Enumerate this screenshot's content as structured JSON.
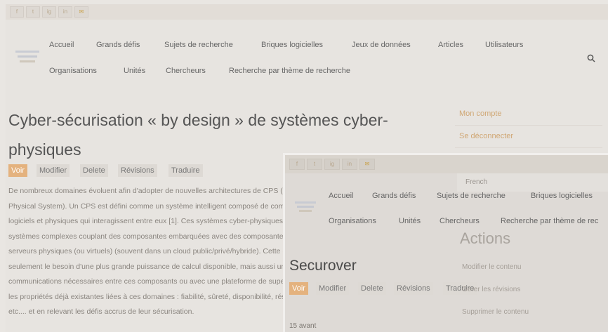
{
  "social": [
    "f",
    "t",
    "ig",
    "in",
    "mail"
  ],
  "nav": {
    "row1": [
      "Accueil",
      "Grands défis",
      "Sujets de recherche",
      "Briques logicielles",
      "Jeux de données",
      "Articles",
      "Utilisateurs"
    ],
    "row2": [
      "Organisations",
      "Unités",
      "Chercheurs",
      "Recherche par thème de recherche"
    ]
  },
  "page": {
    "title_line1": "Cyber-sécurisation « by design » de systèmes cyber-",
    "title_line2": "physiques",
    "tabs": [
      "Voir",
      "Modifier",
      "Delete",
      "Révisions",
      "Traduire"
    ],
    "body_lines": [
      "De nombreux domaines évoluent afin d'adopter de nouvelles architectures de CPS (Cyber-",
      "Physical System). Un CPS est défini comme un système intelligent composé de composants",
      "logiciels et physiques qui interagissent entre eux [1]. Ces systèmes cyber-physiques sont des",
      "systèmes complexes couplant des composantes embarquées avec des composantes hébergées sur des",
      "serveurs physiques (ou virtuels) (souvent dans un cloud public/privé/hybride). Cette évolution implique non",
      "seulement le besoin d'une plus grande puissance de calcul disponible, mais aussi un renforcement des",
      "communications nécessaires entre ces composants ou avec une plateforme de supervision, en plus de",
      "les propriétés déjà existantes liées à ces domaines : fiabilité, sûreté, disponibilité, résilience, intégrité...",
      "etc.... et en relevant les défis accrus de leur sécurisation."
    ]
  },
  "sidebar": {
    "links": [
      "Mon compte",
      "Se déconnecter"
    ]
  },
  "overlay": {
    "social": [
      "f",
      "t",
      "ig",
      "in",
      "mail"
    ],
    "language": "French",
    "nav_row1": [
      "Accueil",
      "Grands défis",
      "Sujets de recherche",
      "Briques logicielles"
    ],
    "nav_row2": [
      "Organisations",
      "Unités",
      "Chercheurs",
      "Recherche par thème de rec"
    ],
    "actions_heading": "Actions",
    "title": "Securover",
    "tabs": [
      "Voir",
      "Modifier",
      "Delete",
      "Révisions",
      "Traduire"
    ],
    "side_links": [
      "Modifier le contenu",
      "Gérer les révisions",
      "Supprimer le contenu"
    ],
    "date": "15 avant"
  },
  "colors": {
    "accent": "#e4b27e",
    "link": "#d0a774"
  }
}
